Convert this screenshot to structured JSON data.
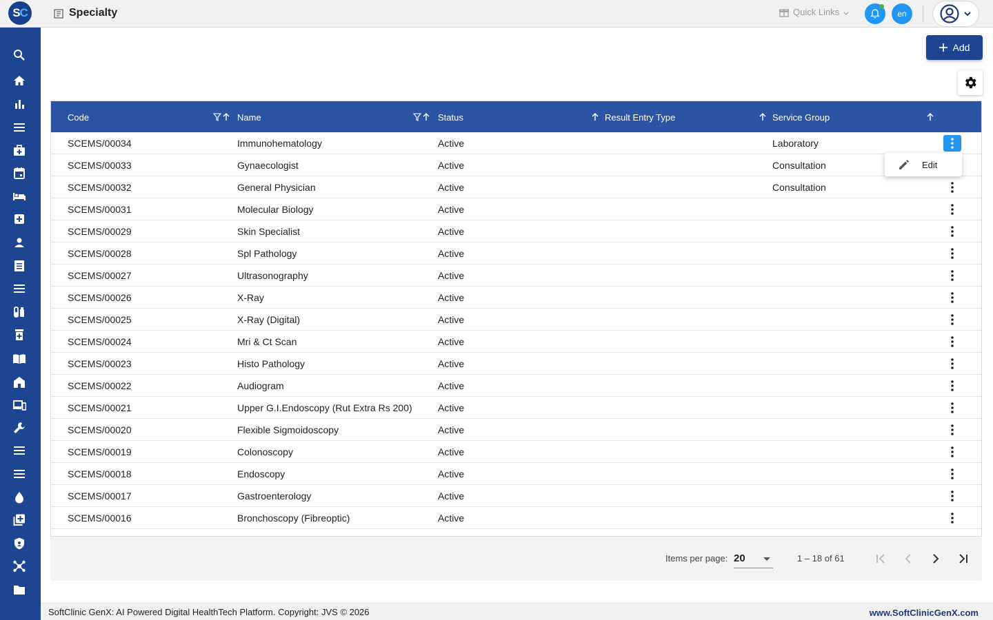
{
  "app": {
    "logo_text_s": "S",
    "logo_text_c": "C",
    "page_title": "Specialty"
  },
  "header": {
    "quick_links": "Quick Links",
    "lang": "en"
  },
  "sidebar": {
    "items": [
      {
        "icon": "search-icon"
      },
      {
        "icon": "home-icon"
      },
      {
        "icon": "bar-chart-icon"
      },
      {
        "icon": "menu-icon"
      },
      {
        "icon": "medical-bag-icon"
      },
      {
        "icon": "calendar-icon"
      },
      {
        "icon": "bed-icon"
      },
      {
        "icon": "plus-box-icon"
      },
      {
        "icon": "person-icon"
      },
      {
        "icon": "list-icon"
      },
      {
        "icon": "menu-icon"
      },
      {
        "icon": "vials-icon"
      },
      {
        "icon": "pill-box-icon"
      },
      {
        "icon": "book-open-icon"
      },
      {
        "icon": "hospital-icon"
      },
      {
        "icon": "devices-icon"
      },
      {
        "icon": "wrench-icon"
      },
      {
        "icon": "menu-icon"
      },
      {
        "icon": "menu-icon"
      },
      {
        "icon": "drop-icon"
      },
      {
        "icon": "library-add-icon"
      },
      {
        "icon": "shield-icon"
      },
      {
        "icon": "hub-icon"
      },
      {
        "icon": "folder-icon"
      }
    ]
  },
  "toolbar": {
    "add_label": "Add"
  },
  "table": {
    "columns": {
      "code": "Code",
      "name": "Name",
      "status": "Status",
      "result_entry_type": "Result Entry Type",
      "service_group": "Service Group"
    },
    "rows": [
      {
        "code": "SCEMS/00034",
        "name": "Immunohematology",
        "status": "Active",
        "result_entry_type": "",
        "service_group": "Laboratory"
      },
      {
        "code": "SCEMS/00033",
        "name": "Gynaecologist",
        "status": "Active",
        "result_entry_type": "",
        "service_group": "Consultation"
      },
      {
        "code": "SCEMS/00032",
        "name": "General Physician",
        "status": "Active",
        "result_entry_type": "",
        "service_group": "Consultation"
      },
      {
        "code": "SCEMS/00031",
        "name": "Molecular Biology",
        "status": "Active",
        "result_entry_type": "",
        "service_group": ""
      },
      {
        "code": "SCEMS/00029",
        "name": "Skin Specialist",
        "status": "Active",
        "result_entry_type": "",
        "service_group": ""
      },
      {
        "code": "SCEMS/00028",
        "name": "Spl Pathology",
        "status": "Active",
        "result_entry_type": "",
        "service_group": ""
      },
      {
        "code": "SCEMS/00027",
        "name": "Ultrasonography",
        "status": "Active",
        "result_entry_type": "",
        "service_group": ""
      },
      {
        "code": "SCEMS/00026",
        "name": "X-Ray",
        "status": "Active",
        "result_entry_type": "",
        "service_group": ""
      },
      {
        "code": "SCEMS/00025",
        "name": "X-Ray (Digital)",
        "status": "Active",
        "result_entry_type": "",
        "service_group": ""
      },
      {
        "code": "SCEMS/00024",
        "name": "Mri & Ct Scan",
        "status": "Active",
        "result_entry_type": "",
        "service_group": ""
      },
      {
        "code": "SCEMS/00023",
        "name": "Histo Pathology",
        "status": "Active",
        "result_entry_type": "",
        "service_group": ""
      },
      {
        "code": "SCEMS/00022",
        "name": "Audiogram",
        "status": "Active",
        "result_entry_type": "",
        "service_group": ""
      },
      {
        "code": "SCEMS/00021",
        "name": "Upper G.I.Endoscopy (Rut Extra Rs 200)",
        "status": "Active",
        "result_entry_type": "",
        "service_group": ""
      },
      {
        "code": "SCEMS/00020",
        "name": "Flexible Sigmoidoscopy",
        "status": "Active",
        "result_entry_type": "",
        "service_group": ""
      },
      {
        "code": "SCEMS/00019",
        "name": "Colonoscopy",
        "status": "Active",
        "result_entry_type": "",
        "service_group": ""
      },
      {
        "code": "SCEMS/00018",
        "name": "Endoscopy",
        "status": "Active",
        "result_entry_type": "",
        "service_group": ""
      },
      {
        "code": "SCEMS/00017",
        "name": "Gastroenterology",
        "status": "Active",
        "result_entry_type": "",
        "service_group": ""
      },
      {
        "code": "SCEMS/00016",
        "name": "Bronchoscopy (Fibreoptic)",
        "status": "Active",
        "result_entry_type": "",
        "service_group": ""
      }
    ]
  },
  "context_menu": {
    "edit_label": "Edit"
  },
  "paginator": {
    "items_per_page_label": "Items per page:",
    "items_per_page_value": "20",
    "range_label": "1 – 18 of 61"
  },
  "footer": {
    "left_text": "SoftClinic GenX: AI Powered Digital HealthTech Platform. Copyright: JVS © 2026",
    "right_text": "www.SoftClinicGenX.com"
  },
  "colors": {
    "brand": "#1e4592",
    "header_row": "#2b54a4",
    "accent": "#2196f3"
  }
}
